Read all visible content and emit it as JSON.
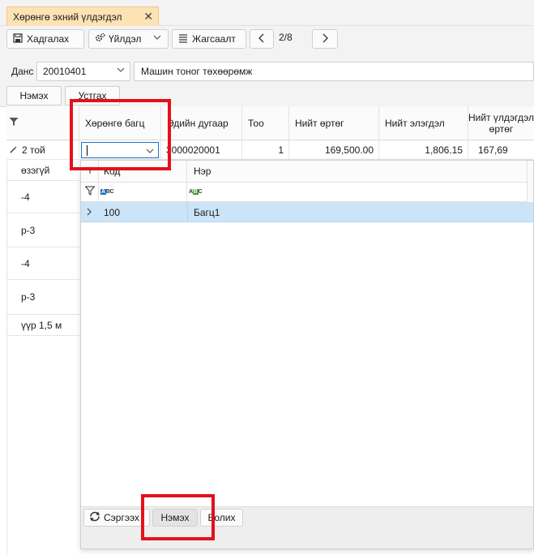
{
  "tab": {
    "title": "Хөрөнгө эхний үлдэгдэл",
    "close_icon": "✕"
  },
  "toolbar": {
    "save_label": "Хадгалах",
    "actions_label": "Үйлдэл",
    "list_label": "Жагсаалт",
    "page": "2/8"
  },
  "account": {
    "label": "Данс",
    "code": "20010401",
    "name": "Машин тоног төхөөрөмж"
  },
  "row_buttons": {
    "add_label": "Нэмэх",
    "delete_label": "Устгах"
  },
  "grid": {
    "columns": [
      "Хөрөнгө багц",
      "Эдийн дугаар",
      "Тоо",
      "Нийт өртөг",
      "Нийт элэгдэл",
      "Нийт үлдэгдэл өртөг"
    ],
    "row": {
      "name": "2 той",
      "item_no": "3000020001",
      "qty": "1",
      "cost": "169,500.00",
      "depreciation": "1,806.15",
      "residual": "167,69"
    },
    "left_rows": [
      "өзэгүй",
      "-4",
      "р-3",
      "-4",
      "р-3",
      "үүр 1,5 м"
    ]
  },
  "popup": {
    "col_code": "Код",
    "col_name": "Нэр",
    "abc_a": "A",
    "abc_bc": "BC",
    "selected_row": {
      "code": "100",
      "name": "Багц1"
    },
    "footer": {
      "refresh_label": "Сэргээх",
      "add_label": "Нэмэх",
      "close_label": "Болих"
    }
  },
  "colors": {
    "tab_bg": "#fde2b4",
    "selected_row": "#cce4f7",
    "highlight": "#e2121c"
  }
}
